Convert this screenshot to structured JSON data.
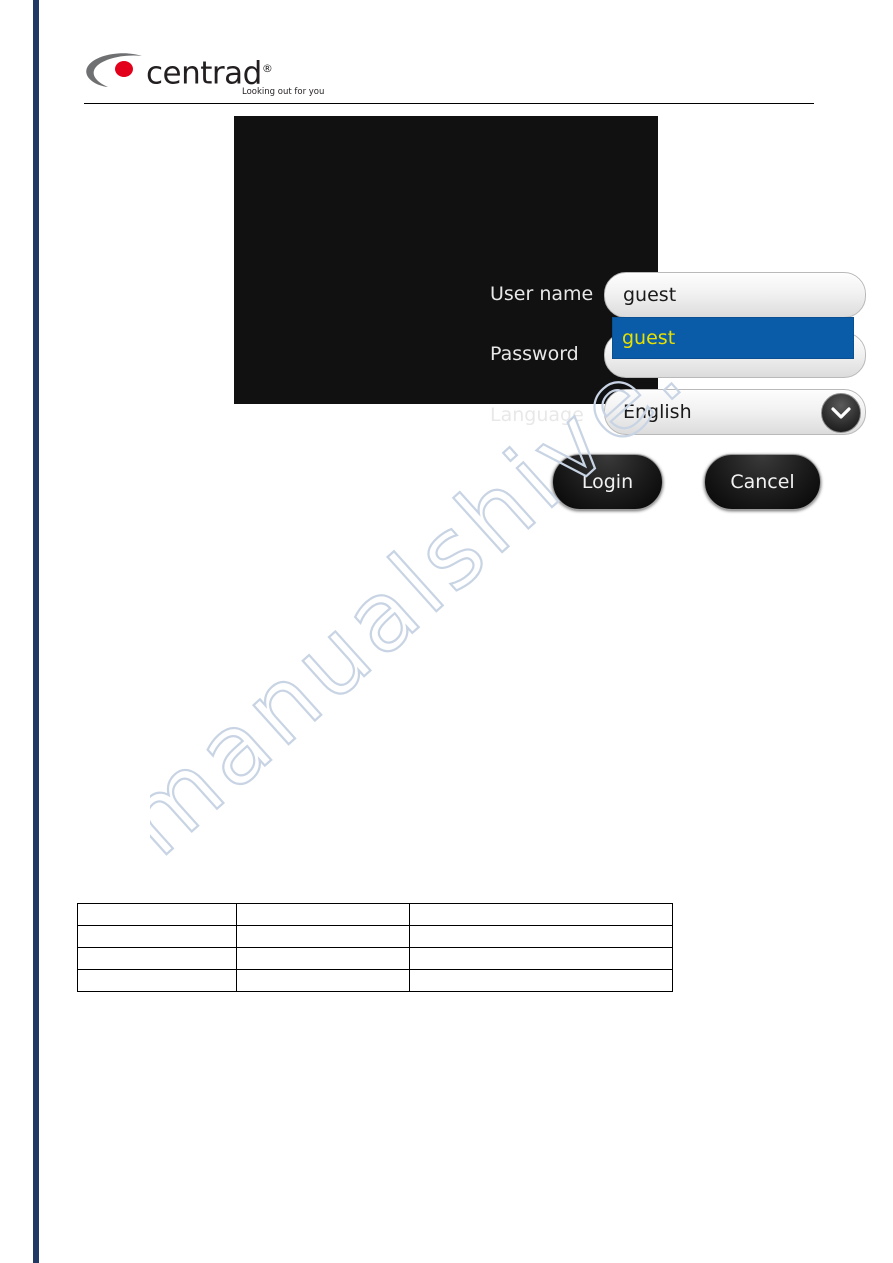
{
  "page": {
    "brand": {
      "name": "centrad",
      "registered_mark": "®",
      "tagline": "Looking out for you",
      "dot_color": "#e2001a",
      "swoosh_color": "#6f7072"
    },
    "accent_bar_color": "#1f3864"
  },
  "dialog": {
    "background": "#111111",
    "fields": [
      {
        "label": "User name",
        "value": "guest",
        "placeholder": ""
      },
      {
        "label": "Password",
        "value": "",
        "placeholder": ""
      },
      {
        "label": "Language",
        "value": "English",
        "placeholder": ""
      }
    ],
    "autocomplete": {
      "value": "guest",
      "highlight_color": "#0a5ca8",
      "text_color": "#e8e000"
    },
    "language_options": [
      "English"
    ],
    "buttons": {
      "login": "Login",
      "cancel": "Cancel"
    },
    "icons": {
      "dropdown": "chevron-down-icon"
    }
  },
  "watermark": {
    "text": "manualshive.com",
    "color": "#c8d4e4"
  },
  "table": {
    "rows": [
      [
        "",
        "",
        ""
      ],
      [
        "",
        "",
        ""
      ],
      [
        "",
        "",
        ""
      ],
      [
        "",
        "",
        ""
      ]
    ]
  }
}
